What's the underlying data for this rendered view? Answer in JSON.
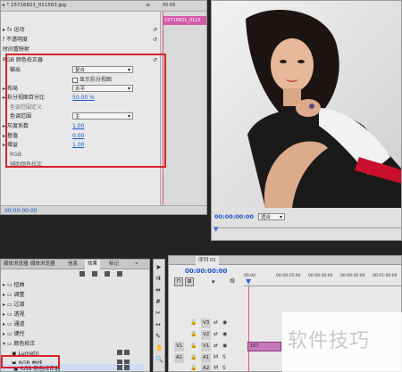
{
  "effect_controls": {
    "clip_title": "15716821_011563.jpg",
    "mini_timeline_time": "00:00",
    "mini_clip_label": "15716821_0115",
    "sections": [
      {
        "label": "运动"
      },
      {
        "label": "不透明度"
      },
      {
        "label": "时间重映射"
      }
    ],
    "effect_name": "RGB 颜色校正器",
    "params": [
      {
        "name": "输出",
        "type": "select",
        "value": "复合"
      },
      {
        "name": "",
        "type": "checkbox",
        "value": "显示拆分视图"
      },
      {
        "name": "布局",
        "type": "select",
        "value": "水平"
      },
      {
        "name": "拆分视图百分比",
        "type": "link",
        "value": "50.00 %"
      },
      {
        "name": "色调范围定义",
        "type": "label",
        "value": ""
      },
      {
        "name": "色调范围",
        "type": "select",
        "value": "主"
      },
      {
        "name": "灰度系数",
        "type": "link",
        "value": "1.00"
      },
      {
        "name": "基值",
        "type": "link",
        "value": "0.00"
      },
      {
        "name": "增益",
        "type": "link",
        "value": "1.00"
      },
      {
        "name": "RGB",
        "type": "label",
        "value": ""
      },
      {
        "name": "辅助颜色校正",
        "type": "label",
        "value": ""
      }
    ],
    "timecode": "00:00:00:00"
  },
  "monitor": {
    "timecode": "00:00:00:00",
    "fit_select": "适合"
  },
  "effects_panel": {
    "tabs": [
      "媒体浏览器",
      "媒体浏览器",
      "信息",
      "效果",
      "标记"
    ],
    "active_tab": "效果",
    "tree": [
      {
        "label": "扭曲"
      },
      {
        "label": "调整"
      },
      {
        "label": "过渡"
      },
      {
        "label": "透视"
      },
      {
        "label": "通道"
      },
      {
        "label": "键控"
      },
      {
        "label": "颜色校正"
      },
      {
        "label": "Lumetri"
      },
      {
        "label": "RGB 曲线"
      },
      {
        "label": "RGB 颜色校正器"
      }
    ]
  },
  "timeline": {
    "tab_label": "序列 01",
    "timecode": "00:00:00:00",
    "ruler_labels": [
      "00:00",
      "00:00:15:00",
      "00:00:30:00",
      "00:00:45:00",
      "00:01:00:00"
    ],
    "tracks": [
      {
        "label": "V3"
      },
      {
        "label": "V2"
      },
      {
        "label": "V1",
        "source": "V1",
        "clip": "157"
      },
      {
        "label": "A1",
        "source": "A1"
      },
      {
        "label": "A2"
      }
    ]
  },
  "watermark": "软件技巧",
  "colors": {
    "highlight_red": "#d8242a",
    "playhead_pink": "#e8508c",
    "link_blue": "#1a55c9"
  }
}
